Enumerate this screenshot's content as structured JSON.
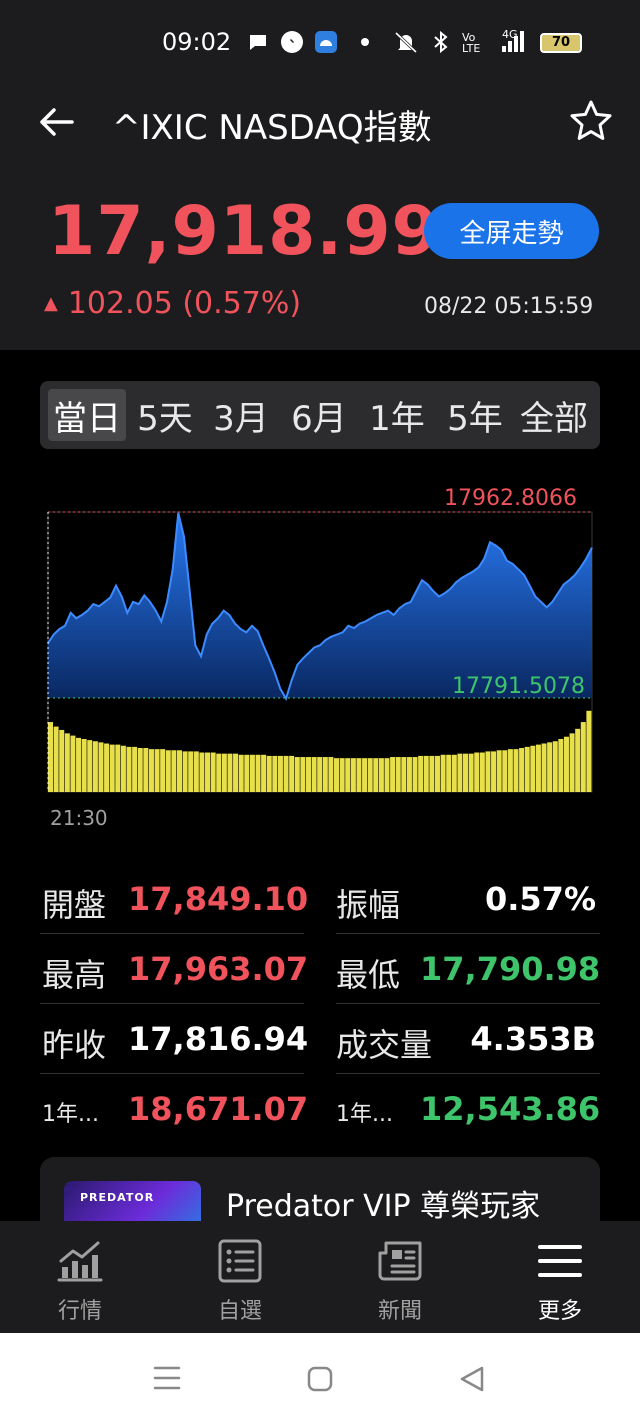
{
  "status_bar": {
    "time": "09:02",
    "battery": "70",
    "network": "4G"
  },
  "header": {
    "title": "^IXIC NASDAQ指數",
    "price": "17,918.99",
    "change": "102.05 (0.57%)",
    "timestamp": "08/22 05:15:59",
    "fullscreen_button": "全屏走勢"
  },
  "range_tabs": [
    "當日",
    "5天",
    "3月",
    "6月",
    "1年",
    "5年",
    "全部"
  ],
  "chart": {
    "high_label": "17962.8066",
    "low_label": "17791.5078",
    "start_time_label": "21:30"
  },
  "chart_data": {
    "type": "area",
    "y_range": [
      17791.5078,
      17962.8066
    ],
    "series": [
      {
        "values": [
          17842,
          17850,
          17855,
          17858,
          17870,
          17865,
          17868,
          17872,
          17878,
          17876,
          17880,
          17884,
          17895,
          17885,
          17870,
          17880,
          17878,
          17886,
          17880,
          17872,
          17862,
          17880,
          17910,
          17962,
          17940,
          17890,
          17840,
          17830,
          17850,
          17860,
          17865,
          17872,
          17868,
          17860,
          17855,
          17852,
          17858,
          17853,
          17840,
          17828,
          17815,
          17800,
          17791,
          17808,
          17822,
          17828,
          17833,
          17838,
          17840,
          17845,
          17848,
          17850,
          17852,
          17858,
          17856,
          17860,
          17862,
          17865,
          17868,
          17870,
          17872,
          17868,
          17874,
          17878,
          17880,
          17890,
          17900,
          17896,
          17890,
          17885,
          17888,
          17892,
          17898,
          17902,
          17905,
          17908,
          17912,
          17920,
          17935,
          17932,
          17928,
          17918,
          17915,
          17910,
          17905,
          17895,
          17885,
          17880,
          17875,
          17880,
          17888,
          17896,
          17900,
          17905,
          17912,
          17920,
          17930
        ]
      },
      {
        "name": "volume",
        "values": [
          0.62,
          0.58,
          0.55,
          0.52,
          0.5,
          0.48,
          0.47,
          0.46,
          0.45,
          0.44,
          0.43,
          0.42,
          0.42,
          0.41,
          0.4,
          0.4,
          0.39,
          0.39,
          0.38,
          0.38,
          0.38,
          0.37,
          0.37,
          0.37,
          0.36,
          0.36,
          0.36,
          0.35,
          0.35,
          0.35,
          0.34,
          0.34,
          0.34,
          0.34,
          0.33,
          0.33,
          0.33,
          0.33,
          0.33,
          0.32,
          0.32,
          0.32,
          0.32,
          0.32,
          0.31,
          0.31,
          0.31,
          0.31,
          0.31,
          0.31,
          0.31,
          0.3,
          0.3,
          0.3,
          0.3,
          0.3,
          0.3,
          0.3,
          0.3,
          0.3,
          0.3,
          0.31,
          0.31,
          0.31,
          0.31,
          0.31,
          0.32,
          0.32,
          0.32,
          0.32,
          0.33,
          0.33,
          0.33,
          0.34,
          0.34,
          0.34,
          0.35,
          0.35,
          0.36,
          0.36,
          0.37,
          0.37,
          0.38,
          0.38,
          0.39,
          0.4,
          0.41,
          0.42,
          0.43,
          0.44,
          0.45,
          0.47,
          0.49,
          0.52,
          0.56,
          0.62,
          0.72
        ]
      }
    ]
  },
  "stats": [
    {
      "label": "開盤",
      "value": "17,849.10",
      "color": "red"
    },
    {
      "label": "振幅",
      "value": "0.57%",
      "color": "white"
    },
    {
      "label": "最高",
      "value": "17,963.07",
      "color": "red"
    },
    {
      "label": "最低",
      "value": "17,790.98",
      "color": "green"
    },
    {
      "label": "昨收",
      "value": "17,816.94",
      "color": "white"
    },
    {
      "label": "成交量",
      "value": "4.353B",
      "color": "white"
    },
    {
      "label": "1年...",
      "value": "18,671.07",
      "color": "red"
    },
    {
      "label": "1年...",
      "value": "12,543.86",
      "color": "green"
    }
  ],
  "ad": {
    "brand": "PREDATOR",
    "title": "Predator VIP 尊榮玩家"
  },
  "bottom_nav": [
    {
      "label": "行情",
      "icon": "chart-icon"
    },
    {
      "label": "自選",
      "icon": "list-icon"
    },
    {
      "label": "新聞",
      "icon": "news-icon"
    },
    {
      "label": "更多",
      "icon": "menu-icon"
    }
  ],
  "colors": {
    "up": "#f0535b",
    "down": "#3ec56b",
    "accent": "#1a73e8",
    "area": "#1e6fd9",
    "volume": "#e8e04a"
  }
}
